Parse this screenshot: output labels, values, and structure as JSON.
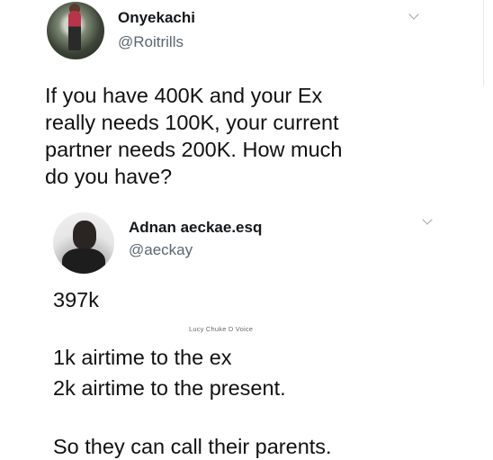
{
  "tweet": {
    "author_name": "Onyekachi",
    "author_handle": "@Roitrills",
    "text": "If you have 400K and your Ex\nreally needs 100K, your current\npartner needs 200K.  How much\ndo you have?"
  },
  "reply": {
    "author_name": "Adnan aeckae.esq",
    "author_handle": "@aeckay",
    "line1": "397k",
    "line2": "1k airtime to the ex",
    "line3": "2k airtime to the present.",
    "line4": "So they can call their parents."
  },
  "watermark": "Lucy Chuke D Voice",
  "icons": {
    "tweet_menu": "chevron-down-icon",
    "reply_menu": "chevron-down-icon"
  }
}
